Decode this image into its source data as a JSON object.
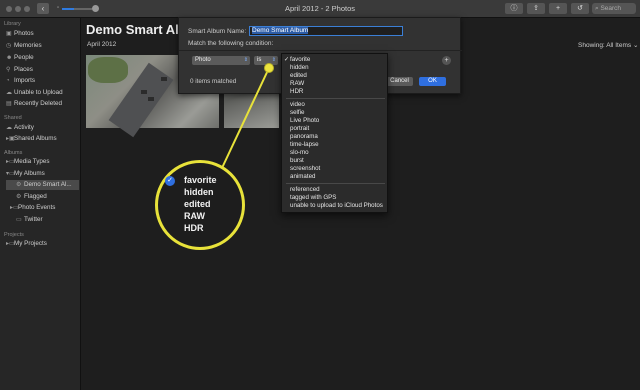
{
  "window": {
    "title": "April 2012 - 2 Photos"
  },
  "toolbar": {
    "back_icon": "chevron-left-icon",
    "zoom_level": 0.4,
    "search_placeholder": "Search",
    "buttons": [
      "info-icon",
      "share-icon",
      "add-icon",
      "rotate-icon",
      "favorite-icon"
    ]
  },
  "sidebar": {
    "library_header": "Library",
    "library_items": [
      {
        "label": "Photos",
        "icon": "photos-icon"
      },
      {
        "label": "Memories",
        "icon": "memories-icon"
      },
      {
        "label": "People",
        "icon": "people-icon"
      },
      {
        "label": "Places",
        "icon": "places-icon"
      },
      {
        "label": "Imports",
        "icon": "imports-icon"
      },
      {
        "label": "Unable to Upload",
        "icon": "cloud-icon"
      },
      {
        "label": "Recently Deleted",
        "icon": "trash-icon"
      }
    ],
    "shared_header": "Shared",
    "shared_items": [
      {
        "label": "Activity",
        "icon": "cloud-icon"
      },
      {
        "label": "Shared Albums",
        "icon": "shared-albums-icon"
      }
    ],
    "albums_header": "Albums",
    "album_items": [
      {
        "label": "Media Types",
        "icon": "folder-icon"
      },
      {
        "label": "My Albums",
        "icon": "folder-icon"
      },
      {
        "label": "Demo Smart Al...",
        "icon": "smart-album-icon"
      },
      {
        "label": "Flagged",
        "icon": "smart-album-icon"
      },
      {
        "label": "Photo Events",
        "icon": "folder-icon"
      },
      {
        "label": "Twitter",
        "icon": "album-icon"
      }
    ],
    "projects_header": "Projects",
    "project_items": [
      {
        "label": "My Projects",
        "icon": "folder-icon"
      }
    ]
  },
  "main": {
    "title": "Demo Smart Alb",
    "subtitle": "April 2012",
    "showing_label": "Showing:",
    "showing_value": "All Items"
  },
  "dialog": {
    "name_label": "Smart Album Name:",
    "name_value": "Demo Smart Album",
    "match_label": "Match the following condition:",
    "field_popup": "Photo",
    "operator_popup": "is",
    "value_popup": "favorite",
    "matched_text": "0 items matched",
    "cancel_label": "Cancel",
    "ok_label": "OK",
    "plus_label": "+"
  },
  "menu": {
    "group1": [
      "favorite",
      "hidden",
      "edited",
      "RAW",
      "HDR"
    ],
    "group2": [
      "video",
      "selfie",
      "Live Photo",
      "portrait",
      "panorama",
      "time-lapse",
      "slo-mo",
      "burst",
      "screenshot",
      "animated"
    ],
    "group3": [
      "referenced",
      "tagged with GPS",
      "unable to upload to iCloud Photos"
    ],
    "checked": "favorite"
  },
  "callout": {
    "items": [
      "favorite",
      "hidden",
      "edited",
      "RAW",
      "HDR"
    ],
    "accent": "#e8e23a"
  }
}
